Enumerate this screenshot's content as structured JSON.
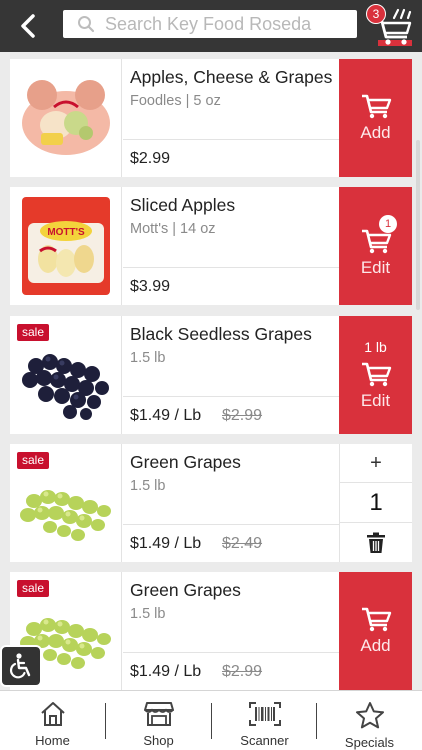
{
  "header": {
    "search_placeholder": "Search Key Food Roseda",
    "cart_count": "3"
  },
  "products": [
    {
      "name": "Apples, Cheese & Grapes",
      "sub": "Foodles | 5 oz",
      "price": "$2.99",
      "action_label": "Add"
    },
    {
      "name": "Sliced Apples",
      "sub": "Mott's | 14 oz",
      "price": "$3.99",
      "action_label": "Edit",
      "cart_qty": "1",
      "package_text": "MOTT'S"
    },
    {
      "name": "Black Seedless Grapes",
      "sub": "1.5 lb",
      "price": "$1.49 / Lb",
      "old_price": "$2.99",
      "action_label": "Edit",
      "action_unit": "1 lb",
      "sale": "sale"
    },
    {
      "name": "Green Grapes",
      "sub": "1.5 lb",
      "price": "$1.49 / Lb",
      "old_price": "$2.49",
      "sale": "sale",
      "stepper": {
        "plus": "+",
        "value": "1"
      }
    },
    {
      "name": "Green Grapes",
      "sub": "1.5 lb",
      "price": "$1.49 / Lb",
      "old_price": "$2.99",
      "action_label": "Add",
      "sale": "sale"
    }
  ],
  "tabs": [
    {
      "label": "Home",
      "icon": "home-icon"
    },
    {
      "label": "Shop",
      "icon": "shop-icon"
    },
    {
      "label": "Scanner",
      "icon": "barcode-icon"
    },
    {
      "label": "Specials",
      "icon": "star-icon"
    }
  ],
  "colors": {
    "accent": "#d9313c",
    "header": "#363636",
    "sale": "#c8102e"
  }
}
